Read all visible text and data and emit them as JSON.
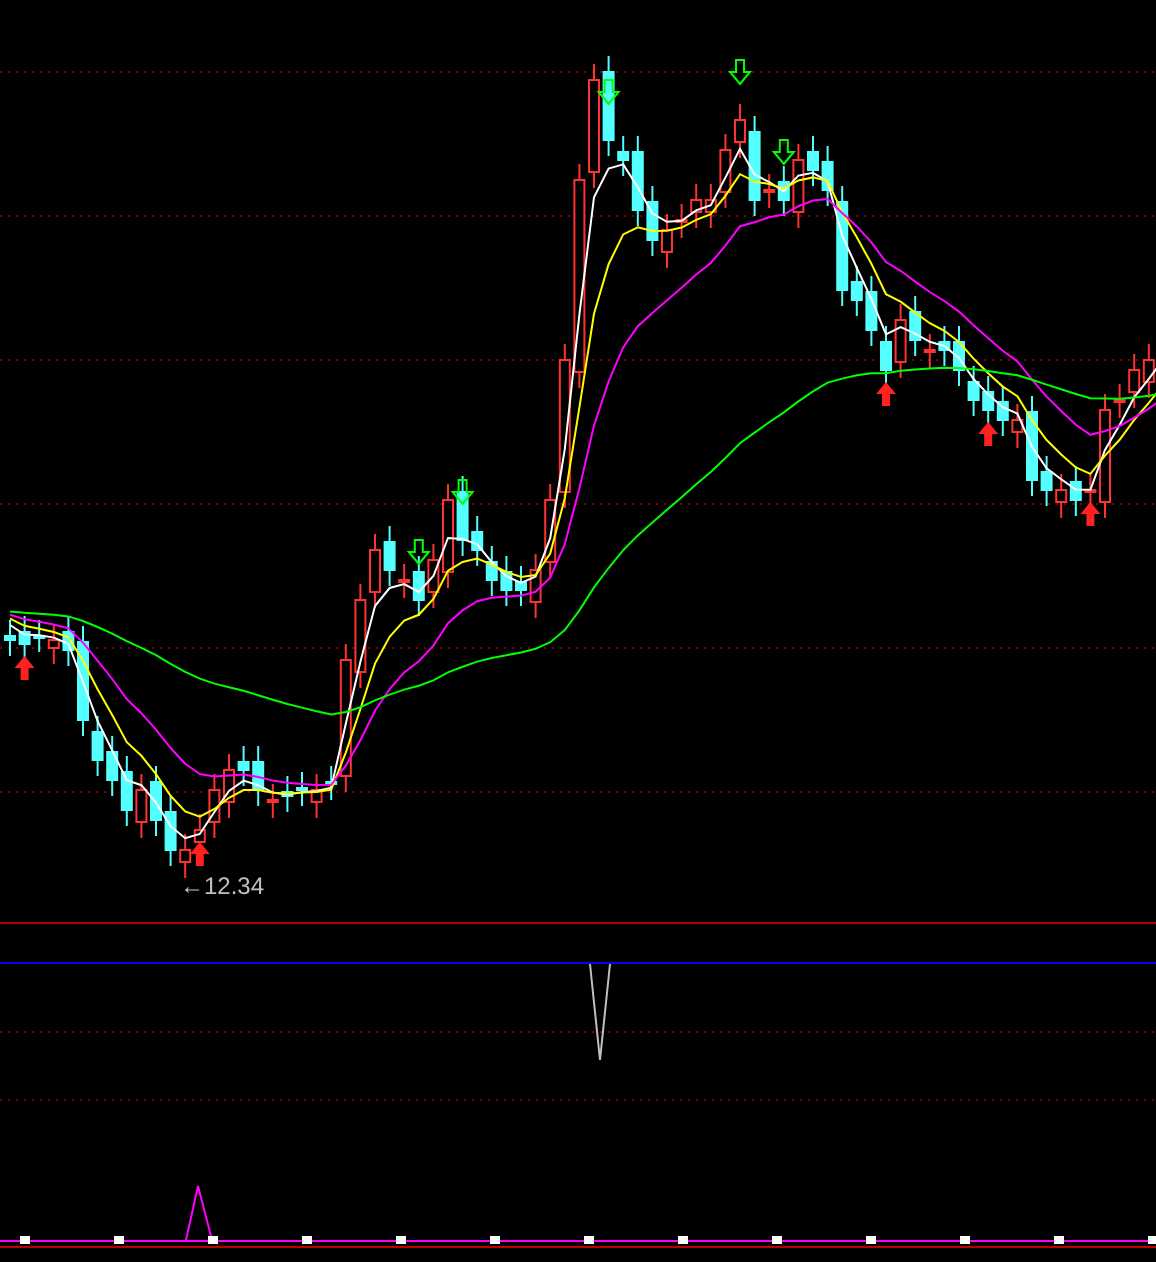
{
  "price_chart": {
    "low_label": "←12.34"
  }
}
